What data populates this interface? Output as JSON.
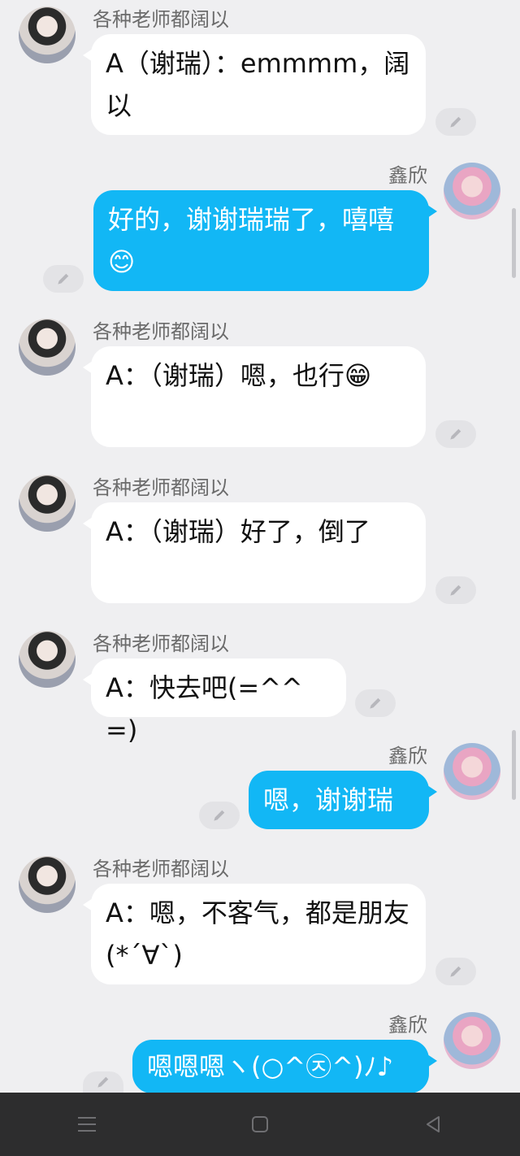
{
  "chat": {
    "messages": [
      {
        "sender": "各种老师都阔以",
        "text": "A（谢瑞）：emmmm，阔以"
      },
      {
        "sender": "鑫欣",
        "text": "好的，谢谢瑞瑞了，嘻嘻😊"
      },
      {
        "sender": "各种老师都阔以",
        "text": "A：（谢瑞）嗯，也行😁"
      },
      {
        "sender": "各种老师都阔以",
        "text": "A：（谢瑞）好了，倒了"
      },
      {
        "sender": "各种老师都阔以",
        "text": "A：快去吧(=^^=)"
      },
      {
        "sender": "鑫欣",
        "text": "嗯，谢谢瑞"
      },
      {
        "sender": "各种老师都阔以",
        "text": "A：嗯，不客气，都是朋友(*´∀`)"
      },
      {
        "sender": "鑫欣",
        "text": "嗯嗯嗯ヽ(○^㉨^)ﾉ♪"
      }
    ]
  },
  "colors": {
    "background": "#efeff1",
    "incoming_bubble": "#ffffff",
    "outgoing_bubble": "#12b7f5",
    "nav_bar": "#2d2d2e"
  },
  "icons": {
    "edit": "pencil-icon",
    "nav_menu": "menu-icon",
    "nav_home": "home-square-icon",
    "nav_back": "back-triangle-icon"
  }
}
